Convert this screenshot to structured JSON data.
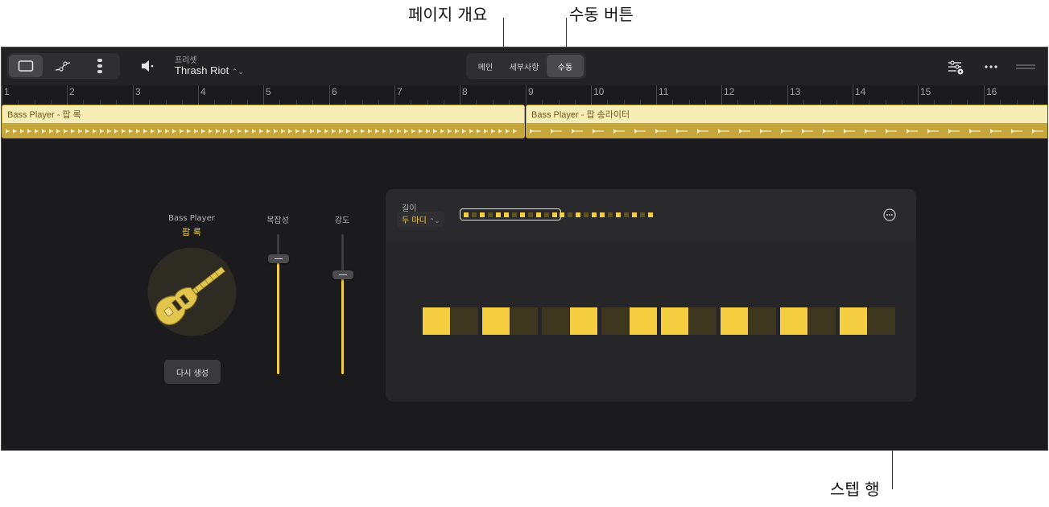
{
  "callouts": {
    "page_overview": "페이지 개요",
    "manual_button": "수동 버튼",
    "step_row": "스텝 행"
  },
  "toolbar": {
    "view_buttons": [
      "single-view-icon",
      "automation-icon",
      "drummer-lanes-icon"
    ],
    "speaker_icon": "speaker-icon",
    "preset_label": "프리셋",
    "preset_name": "Thrash Riot",
    "segments": [
      "메인",
      "세부사항",
      "수동"
    ],
    "active_segment": "수동",
    "right_icons": [
      "sliders-settings-icon",
      "more-icon",
      "resize-handle-icon"
    ]
  },
  "ruler": {
    "bars": [
      "1",
      "2",
      "3",
      "4",
      "5",
      "6",
      "7",
      "8",
      "9",
      "10",
      "11",
      "12",
      "13",
      "14",
      "15",
      "16"
    ]
  },
  "regions": [
    {
      "title": "Bass Player - 팝 록"
    },
    {
      "title": "Bass Player - 팝 송라이터"
    }
  ],
  "player": {
    "label": "Bass Player",
    "style": "팝 록",
    "avatar_icon": "bass-guitar-icon",
    "regenerate_label": "다시 생성"
  },
  "sliders": [
    {
      "label": "복잡성",
      "value": 0.83
    },
    {
      "label": "강도",
      "value": 0.71
    }
  ],
  "pattern": {
    "length_label": "길이",
    "length_value": "두 마디",
    "overview_pages": [
      [
        1,
        0,
        1,
        0,
        1,
        1,
        0,
        1,
        0,
        1,
        0,
        1
      ],
      [
        1,
        0,
        1,
        0,
        1,
        1,
        0,
        1,
        0,
        1,
        0,
        1
      ]
    ],
    "steps": [
      1,
      0,
      1,
      0,
      0,
      1,
      0,
      1,
      1,
      0,
      1,
      0,
      1,
      0,
      1,
      0
    ],
    "colors": {
      "accent": "#f5cf41",
      "step_off": "#3e3720"
    }
  }
}
